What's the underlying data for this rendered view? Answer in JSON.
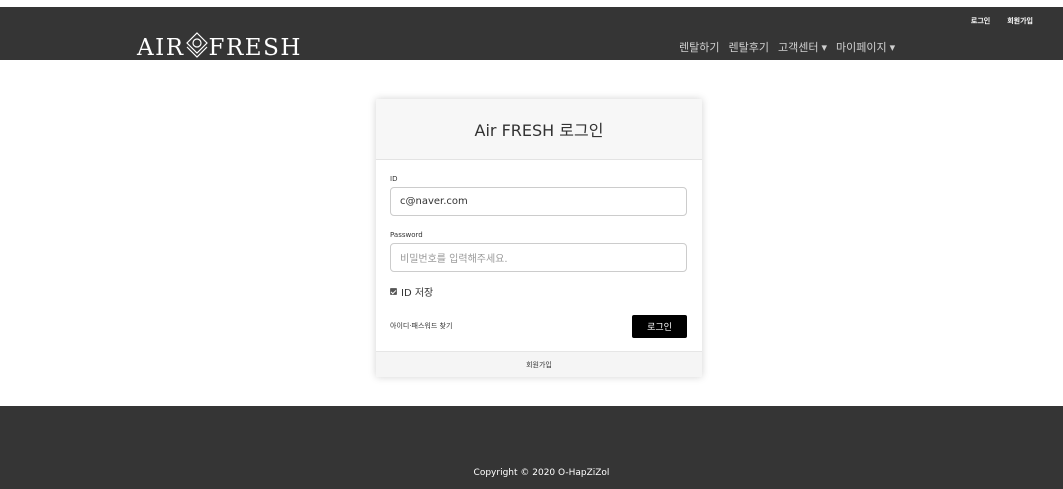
{
  "brand": {
    "name_left": "AIR",
    "name_right": "FRESH"
  },
  "top_links": [
    "로그인",
    "회원가입"
  ],
  "menu": [
    {
      "label": "렌탈하기",
      "dropdown": false
    },
    {
      "label": "렌탈후기",
      "dropdown": false
    },
    {
      "label": "고객센터",
      "dropdown": true
    },
    {
      "label": "마이페이지",
      "dropdown": true
    }
  ],
  "login": {
    "title": "Air FRESH 로그인",
    "id_label": "ID",
    "id_value": "c@naver.com",
    "password_label": "Password",
    "password_placeholder": "비밀번호를 입력해주세요.",
    "remember_label": "ID 저장",
    "remember_checked": true,
    "find_link": "아이디·패스워드 찾기",
    "submit_label": "로그인",
    "signup_link": "회원가입"
  },
  "footer": {
    "copyright": "Copyright © 2020 O-HapZiZol"
  },
  "colors": {
    "navbar_bg": "#353535",
    "button_bg": "#000000"
  },
  "icons": {
    "logo_mark": "diamond-circle-logo-icon",
    "dropdown": "caret-down-icon",
    "checkbox": "checkbox-checked-icon"
  }
}
